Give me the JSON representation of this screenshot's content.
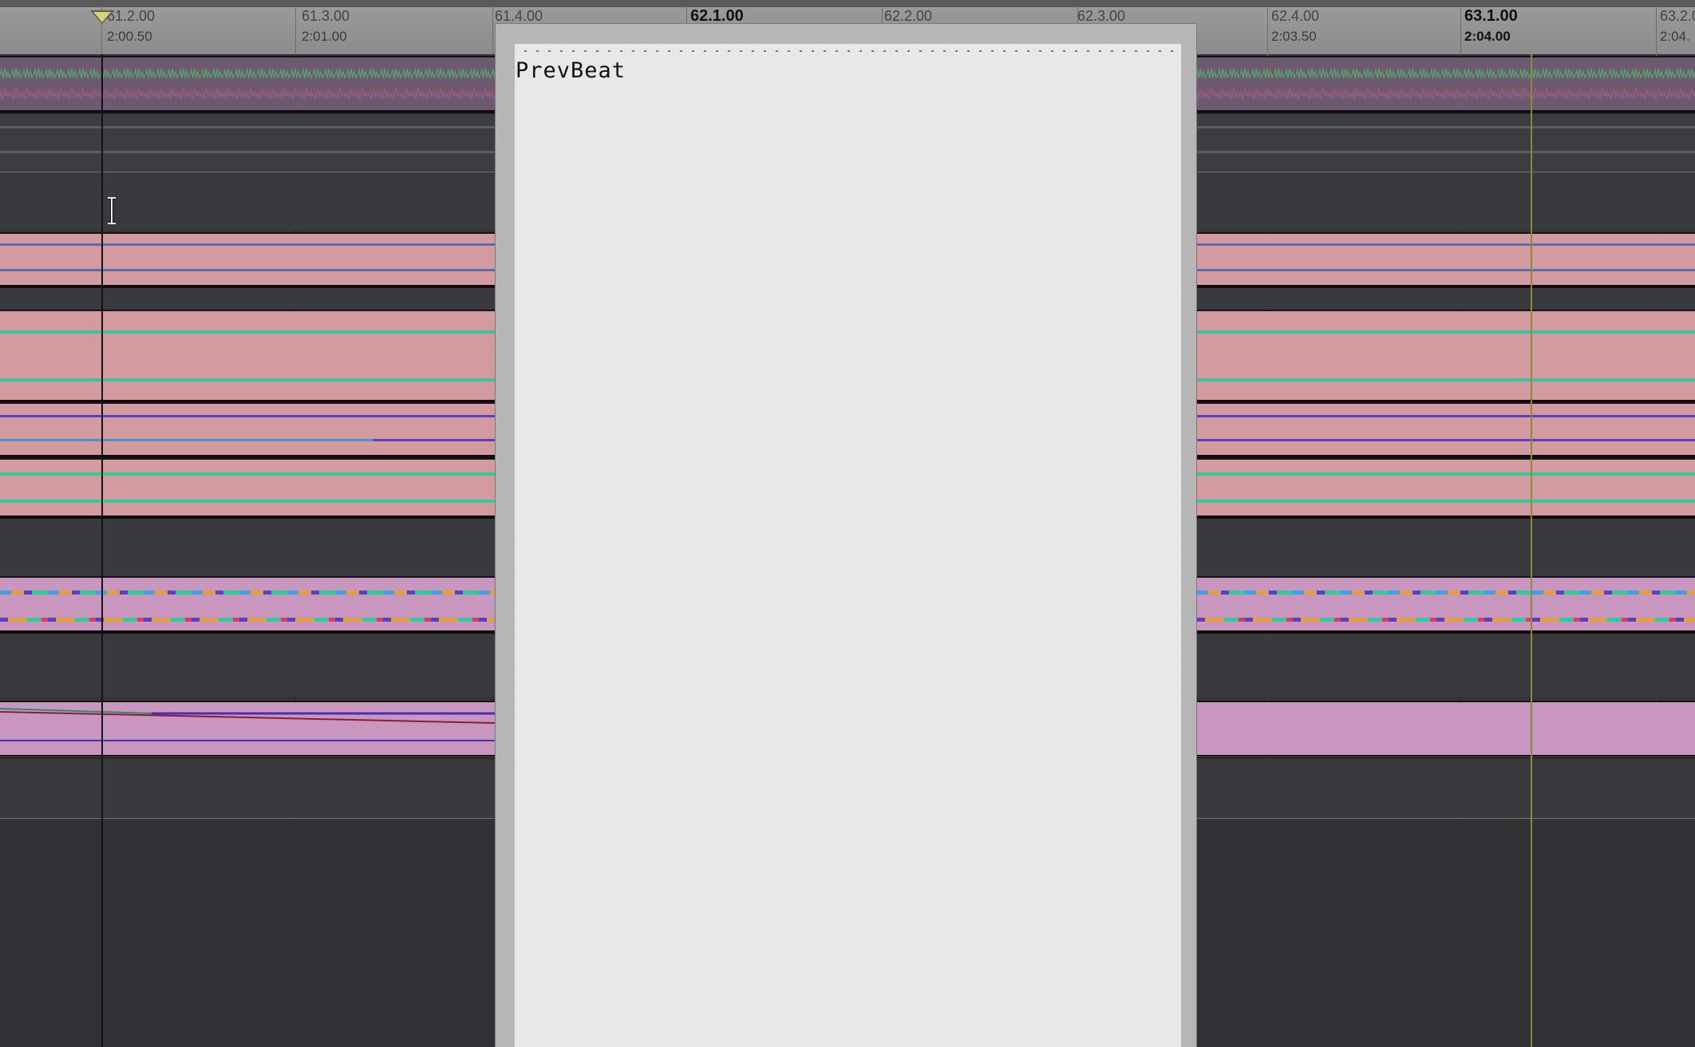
{
  "ruler": {
    "bar_labels": [
      "61.2.00",
      "61.3.00",
      "61.4.00",
      "62.1.00",
      "62.2.00",
      "62.3.00",
      "62.4.00",
      "63.1.00",
      "63.2.0"
    ],
    "time_labels": [
      "2:00.50",
      "2:01.00",
      "2:03.50",
      "2:04.00",
      "2:04."
    ]
  },
  "popup": {
    "title": "PrevBeat"
  },
  "colors": {
    "background": "#353438",
    "region_pink": "#d39aa0",
    "region_magenta": "#c996bf",
    "region_purple_audio": "#a77ea6",
    "popup_bg": "#e9e9e9",
    "playhead_yellow": "#d8d07a"
  },
  "icons": {
    "playhead": "triangle-down-icon",
    "cursor": "ibeam-cursor-icon"
  }
}
